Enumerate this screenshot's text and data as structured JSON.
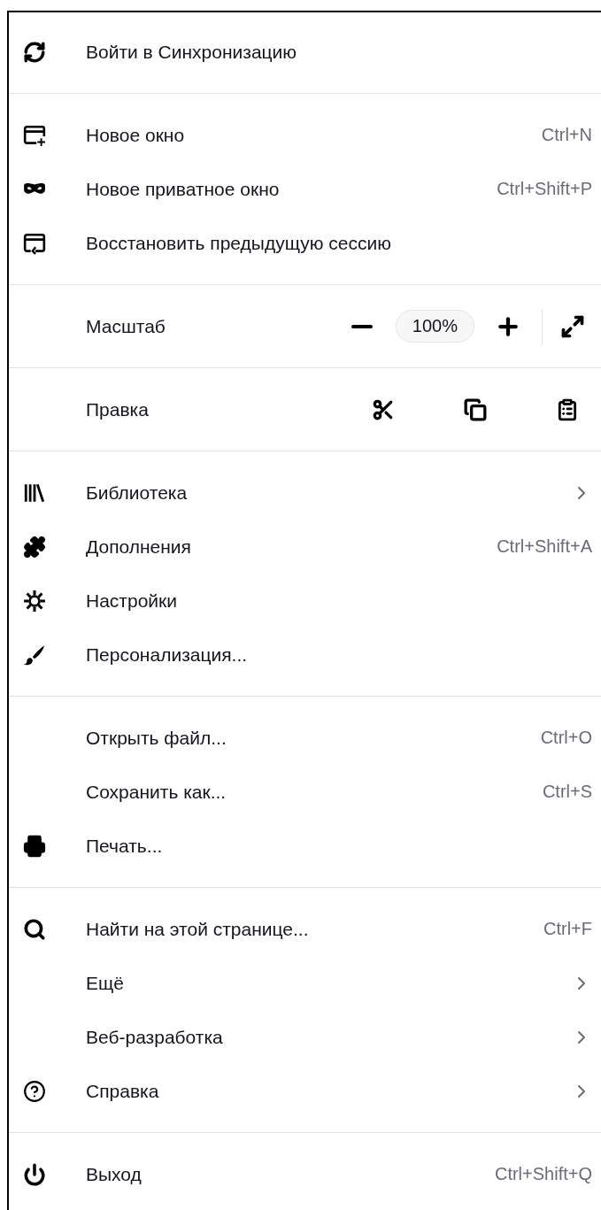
{
  "sections": [
    {
      "items": [
        {
          "kind": "item",
          "label": "Войти в Синхронизацию"
        }
      ]
    },
    {
      "items": [
        {
          "kind": "item",
          "label": "Новое окно",
          "shortcut": "Ctrl+N"
        },
        {
          "kind": "item",
          "label": "Новое приватное окно",
          "shortcut": "Ctrl+Shift+P"
        },
        {
          "kind": "item",
          "label": "Восстановить предыдущую сессию"
        }
      ]
    },
    {
      "items": [
        {
          "kind": "zoom",
          "label": "Масштаб",
          "value": "100%"
        }
      ]
    },
    {
      "items": [
        {
          "kind": "edit",
          "label": "Правка"
        }
      ]
    },
    {
      "items": [
        {
          "kind": "item",
          "label": "Библиотека",
          "submenu": true
        },
        {
          "kind": "item",
          "label": "Дополнения",
          "shortcut": "Ctrl+Shift+A"
        },
        {
          "kind": "item",
          "label": "Настройки"
        },
        {
          "kind": "item",
          "label": "Персонализация..."
        }
      ]
    },
    {
      "items": [
        {
          "kind": "item",
          "label": "Открыть файл...",
          "shortcut": "Ctrl+O"
        },
        {
          "kind": "item",
          "label": "Сохранить как...",
          "shortcut": "Ctrl+S"
        },
        {
          "kind": "item",
          "label": "Печать..."
        }
      ]
    },
    {
      "items": [
        {
          "kind": "item",
          "label": "Найти на этой странице...",
          "shortcut": "Ctrl+F"
        },
        {
          "kind": "item",
          "label": "Ещё",
          "submenu": true
        },
        {
          "kind": "item",
          "label": "Веб-разработка",
          "submenu": true
        },
        {
          "kind": "item",
          "label": "Справка",
          "submenu": true
        }
      ]
    },
    {
      "items": [
        {
          "kind": "item",
          "label": "Выход",
          "shortcut": "Ctrl+Shift+Q"
        }
      ]
    }
  ]
}
